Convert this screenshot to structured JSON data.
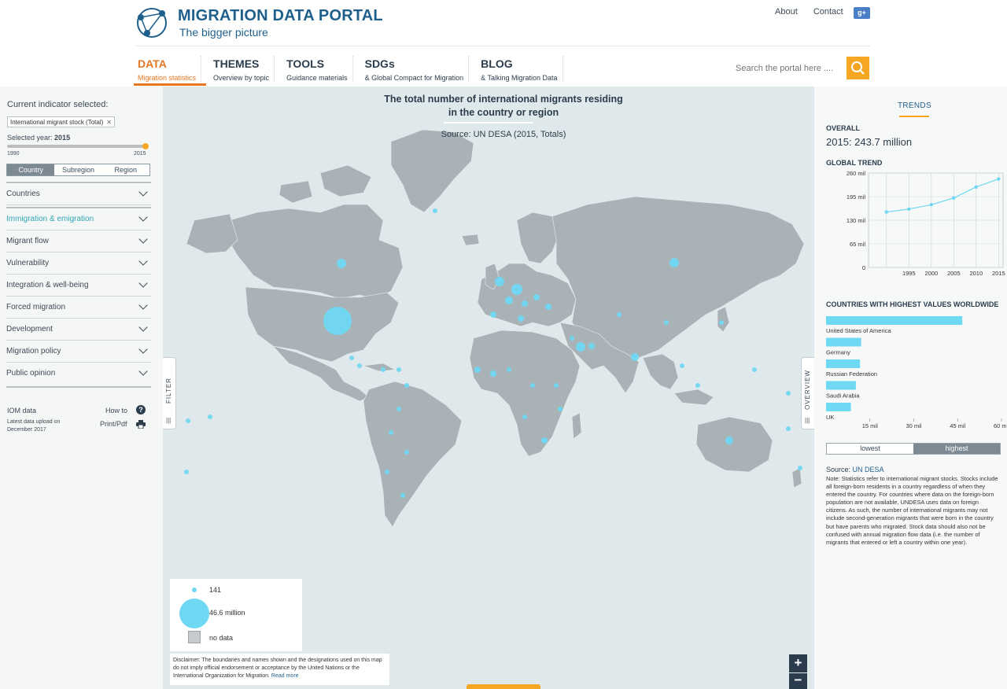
{
  "header": {
    "title": "MIGRATION DATA PORTAL",
    "subtitle": "The bigger picture",
    "links": [
      "About",
      "Contact"
    ],
    "nav": [
      {
        "title": "DATA",
        "sub": "Migration statistics"
      },
      {
        "title": "THEMES",
        "sub": "Overview by topic"
      },
      {
        "title": "TOOLS",
        "sub": "Guidance materials"
      },
      {
        "title": "SDGs",
        "sub": "& Global Compact for Migration"
      },
      {
        "title": "BLOG",
        "sub": "& Talking Migration Data"
      }
    ],
    "search_placeholder": "Search the portal here ...."
  },
  "sidebar": {
    "current_indicator_label": "Current indicator selected:",
    "indicator_tag": "International migrant stock (Total)",
    "selected_year_prefix": "Selected year: ",
    "selected_year": "2015",
    "year_min": "1990",
    "year_max": "2015",
    "level_tabs": [
      "Country",
      "Subregion",
      "Region"
    ],
    "menu": [
      "Countries",
      "Immigration & emigration",
      "Migrant flow",
      "Vulnerability",
      "Integration & well-being",
      "Forced migration",
      "Development",
      "Migration policy",
      "Public opinion"
    ],
    "iom_data": "IOM data",
    "upload_note": "Latest data upload on December 2017",
    "how_to": "How to",
    "print_pdf": "Print/Pdf"
  },
  "map": {
    "title_line1": "The total number of international migrants residing",
    "title_line2": "in the country or region",
    "source": "Source: UN DESA (2015, Totals)",
    "filter_tab": "FILTER",
    "overview_tab": "OVERVIEW",
    "legend": {
      "min": "141",
      "max": "46.6 million",
      "nodata": "no data"
    },
    "disclaimer": "Disclaimer: The boundaries and names shown and the designations used on this map do not imply official endorsement or acceptance by the United Nations or the International Organization for Migration.",
    "read_more": "Read more",
    "zoom_in": "+",
    "zoom_out": "−"
  },
  "trends": {
    "title": "TRENDS",
    "overall_label": "OVERALL",
    "overall_value": "2015: 243.7 million",
    "global_trend_label": "GLOBAL TREND",
    "highest_label": "COUNTRIES WITH HIGHEST VALUES WORLDWIDE",
    "toggle": [
      "lowest",
      "highest"
    ],
    "source_prefix": "Source: ",
    "source_link": "UN DESA",
    "note": "Note: Statistics refer to international migrant stocks. Stocks include all foreign-born residents in a country regardless of when they entered the country. For countries where data on the foreign-born population are not available, UNDESA uses data on foreign citizens. As such, the number of international migrants may not include second-generation migrants that were born in the country but have parents who migrated. Stock data should also not be confused with annual migration flow data (i.e. the number of migrants that entered or left a country within one year)."
  },
  "chart_data": [
    {
      "type": "line",
      "title": "GLOBAL TREND",
      "x": [
        1990,
        1995,
        2000,
        2005,
        2010,
        2015
      ],
      "series": [
        {
          "values": [
            152.5,
            160.7,
            172.7,
            191.3,
            221.7,
            243.7
          ]
        }
      ],
      "y_ticks": [
        "0",
        "65 mil",
        "130 mil",
        "195 mil",
        "260 mil"
      ],
      "ylim": [
        0,
        260
      ],
      "grid": true
    },
    {
      "type": "bar",
      "title": "COUNTRIES WITH HIGHEST VALUES WORLDWIDE",
      "categories": [
        "United States of America",
        "Germany",
        "Russian Federation",
        "Saudi Arabia",
        "UK"
      ],
      "values": [
        46.6,
        12.0,
        11.6,
        10.2,
        8.5
      ],
      "x_ticks": [
        "15 mil",
        "30 mil",
        "45 mil",
        "60 mil"
      ],
      "xlim": [
        0,
        60
      ]
    }
  ],
  "colors": {
    "accent": "#e87722",
    "bubble": "#6fd8f2",
    "land": "#a9b3b7",
    "sea": "#dfe8ea",
    "brand": "#1f5f8c"
  }
}
